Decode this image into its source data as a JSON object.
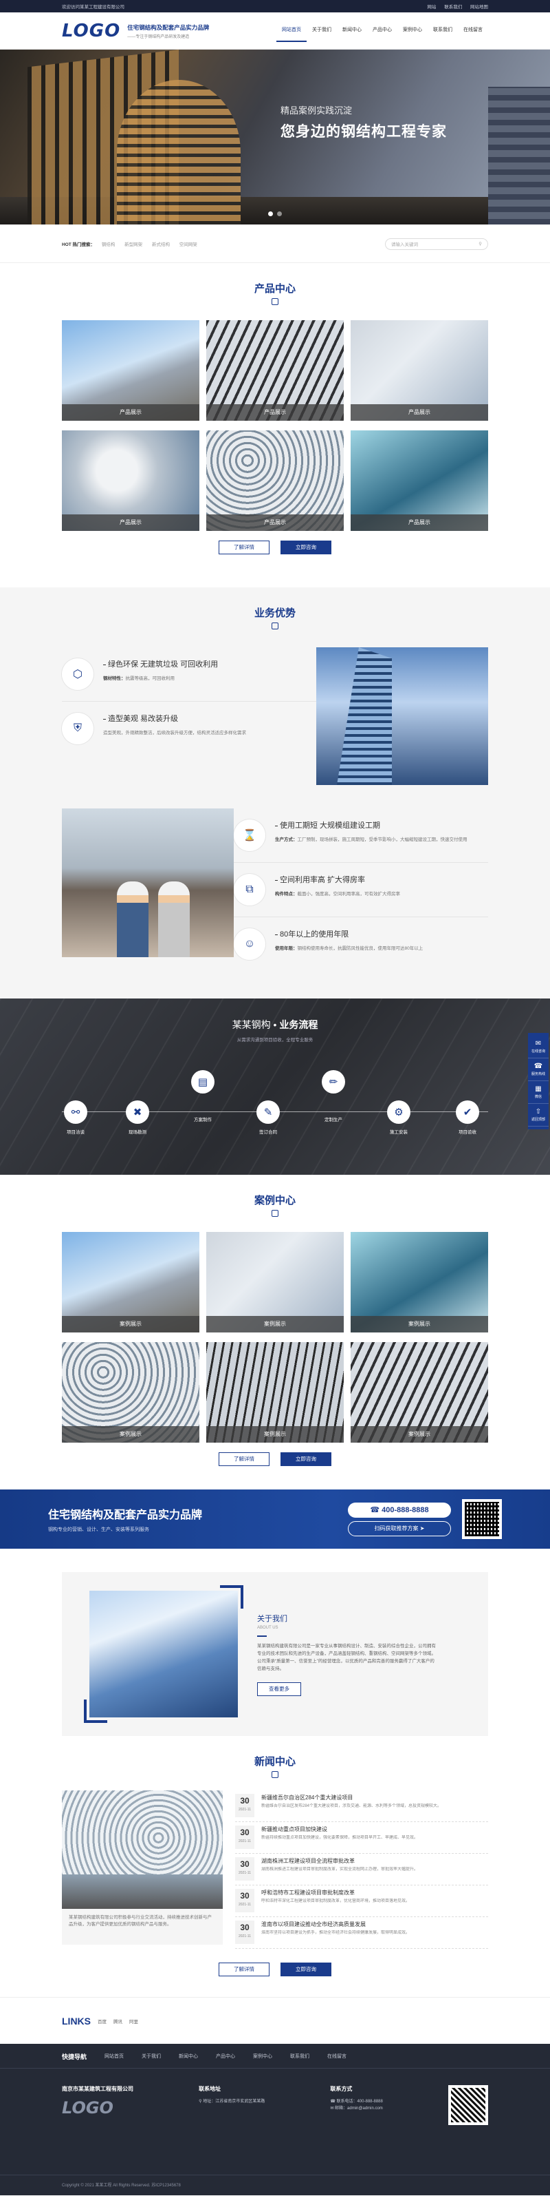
{
  "topbar": {
    "left": "欢迎访问某某工程建设有限公司",
    "links": [
      "网站",
      "联系我们",
      "网站地图"
    ]
  },
  "header": {
    "logo": "LOGO",
    "brand_title": "住宅钢结构及配套产品实力品牌",
    "brand_sub": "——专注于钢结构产品研发及建造",
    "nav": [
      "网站首页",
      "关于我们",
      "新闻中心",
      "产品中心",
      "案例中心",
      "联系我们",
      "在线留言"
    ]
  },
  "banner": {
    "subtitle": "精品案例实践沉淀",
    "title": "您身边的钢结构工程专家"
  },
  "hot": {
    "label": "HOT 热门搜索：",
    "keywords": [
      "钢结构",
      "新型网架",
      "新式结构",
      "空间网架"
    ],
    "search_placeholder": "请输入关键词"
  },
  "products": {
    "title": "产品中心",
    "items": [
      "产品展示",
      "产品展示",
      "产品展示",
      "产品展示",
      "产品展示",
      "产品展示"
    ],
    "btn_more": "了解详情",
    "btn_consult": "立即咨询"
  },
  "advantage": {
    "title": "业务优势",
    "items": [
      {
        "title": "绿色环保 无建筑垃圾 可回收利用",
        "label": "钢材特性：",
        "text": "抗震等级高，可回收利用"
      },
      {
        "title": "造型美观 易改装升级",
        "label": "",
        "text": "造型美观，外观精致整洁，后续改装升级方便，结构灵活适应多样化需求"
      },
      {
        "title": "使用工期短 大规模组建设工期",
        "label": "生产方式：",
        "text": "工厂预制，现场拼装，施工周期短，受季节影响小，大幅缩短建设工期，快速交付使用"
      },
      {
        "title": "空间利用率高 扩大得房率",
        "label": "构件特点：",
        "text": "截面小，强度高，空间利用率高，可有效扩大得房率"
      },
      {
        "title": "80年以上的使用年限",
        "label": "使用年限：",
        "text": "钢结构使用寿命长，抗震防风性能优良，使用年限可达80年以上"
      }
    ]
  },
  "process": {
    "title_prefix": "某某钢构 • ",
    "title_main": "业务流程",
    "subtitle": "从需求沟通到项目验收，全程专业服务",
    "steps": [
      "项目洽谈",
      "现场勘测",
      "方案制作",
      "签订合同",
      "定制生产",
      "施工安装",
      "项目验收"
    ]
  },
  "side": [
    "在线咨询",
    "服务热线",
    "微信",
    "返回顶部"
  ],
  "cases": {
    "title": "案例中心",
    "items": [
      "案例展示",
      "案例展示",
      "案例展示",
      "案例展示",
      "案例展示",
      "案例展示"
    ],
    "btn_more": "了解详情",
    "btn_consult": "立即咨询"
  },
  "brandbar": {
    "title": "住宅钢结构及配套产品实力品牌",
    "sub": "钢构专业的营销、设计、生产、安装等系列服务",
    "phone": "400-888-8888",
    "plan": "扫码获取推荐方案"
  },
  "about": {
    "title": "关于我们",
    "en": "ABOUT US",
    "text": "某某钢结构建筑有限公司是一家专业从事钢结构设计、制造、安装的综合性企业，公司拥有专业的技术团队和先进的生产设备，产品涵盖轻钢结构、重钢结构、空间网架等多个领域。公司秉承“质量第一、信誉至上”的经营理念，以优质的产品和完善的服务赢得了广大客户的信赖与支持。",
    "btn": "查看更多"
  },
  "news": {
    "title": "新闻中心",
    "summary": "某某钢结构建筑有限公司积极参与行业交流活动，持续推进技术创新与产品升级，为客户提供更加优质的钢结构产品与服务。",
    "items": [
      {
        "day": "30",
        "ym": "2021-11",
        "title": "新疆维吾尔自治区284个重大建设项目",
        "text": "新疆维吾尔自治区发布284个重大建设项目，涉及交通、能源、水利等多个领域，总投资规模较大。"
      },
      {
        "day": "30",
        "ym": "2021-11",
        "title": "新疆推动重点项目加快建设",
        "text": "新疆持续推动重点项目加快建设，强化要素保障，推动项目早开工、早建成、早见效。"
      },
      {
        "day": "30",
        "ym": "2021-11",
        "title": "湖南株洲工程建设项目全流程审批改革",
        "text": "湖南株洲推进工程建设项目审批制度改革，实现全流程网上办理，审批效率大幅提升。"
      },
      {
        "day": "30",
        "ym": "2021-11",
        "title": "呼和浩特市工程建设项目审批制度改革",
        "text": "呼和浩特市深化工程建设项目审批制度改革，优化营商环境，推动项目落地见效。"
      },
      {
        "day": "30",
        "ym": "2021-11",
        "title": "淮南市以项目建设推动全市经济高质量发展",
        "text": "淮南市坚持以项目建设为抓手，推动全市经济社会持续健康发展，取得明显成效。"
      }
    ],
    "btn_more": "了解详情",
    "btn_consult": "立即咨询"
  },
  "links": {
    "title": "LINKS",
    "items": [
      "百度",
      "腾讯",
      "阿里"
    ]
  },
  "footer": {
    "nav_title": "快捷导航",
    "nav": [
      "网站首页",
      "关于我们",
      "新闻中心",
      "产品中心",
      "案例中心",
      "联系我们",
      "在线留言"
    ],
    "company": "南京市某某建筑工程有限公司",
    "logo": "LOGO",
    "addr_title": "联系地址",
    "addr": "地址：江苏省南京市玄武区某某路",
    "contact_title": "联系方式",
    "phone": "联系电话：400-888-8888",
    "email": "邮箱：admin@admin.com",
    "copyright": "Copyright © 2021 某某工程 All Rights Reserved. 苏ICP12345678"
  },
  "colors": {
    "primary": "#1a3b8c",
    "topbar": "#1b2238",
    "footer": "#252a36"
  }
}
